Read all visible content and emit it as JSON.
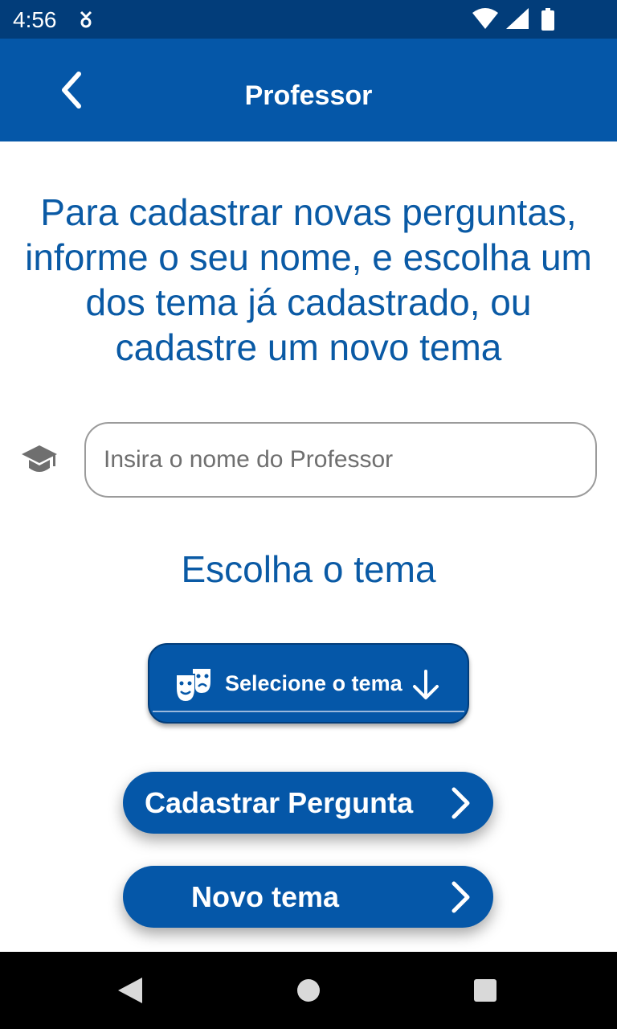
{
  "status_bar": {
    "time": "4:56",
    "icons": [
      "app-notification-icon",
      "wifi-icon",
      "cellular-signal-icon",
      "battery-icon"
    ]
  },
  "app_bar": {
    "title": "Professor",
    "back_icon": "chevron-left-icon",
    "background_color": "#0557a8"
  },
  "intro_text": "Para cadastrar novas perguntas, informe o seu nome, e escolha um dos tema já cadastrado, ou cadastre um novo tema",
  "professor_input": {
    "icon": "graduation-cap-icon",
    "value": "",
    "placeholder": "Insira o nome do Professor"
  },
  "theme_section": {
    "title": "Escolha o tema",
    "select_label": "Selecione o tema",
    "icon": "theater-masks-icon",
    "trailing_icon": "arrow-down-icon"
  },
  "buttons": {
    "cadastrar_label": "Cadastrar Pergunta",
    "novo_tema_label": "Novo tema",
    "trailing_icon": "chevron-right-icon"
  },
  "nav_bar": {
    "icons": [
      "nav-back-icon",
      "nav-home-icon",
      "nav-recents-icon"
    ]
  },
  "colors": {
    "primary": "#0557a8",
    "status_bar": "#023d7a",
    "text_accent": "#0a5aa5"
  }
}
